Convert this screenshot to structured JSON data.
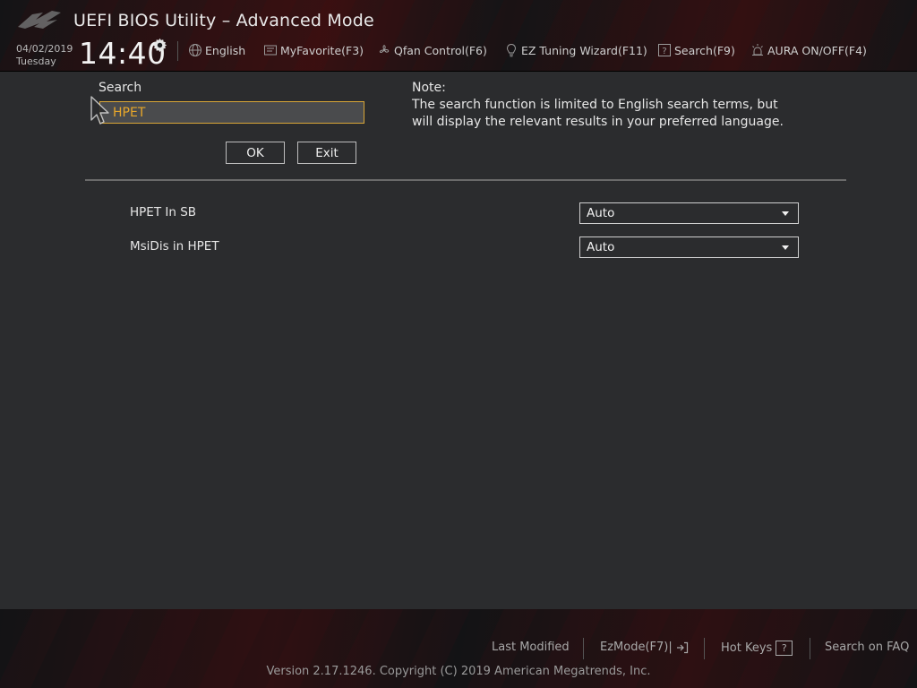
{
  "header": {
    "title": "UEFI BIOS Utility – Advanced Mode",
    "date": "04/02/2019",
    "day": "Tuesday",
    "time": "14:40",
    "toolbar": [
      {
        "icon": "globe-icon",
        "label": "English"
      },
      {
        "icon": "favorite-icon",
        "label": "MyFavorite(F3)"
      },
      {
        "icon": "fan-icon",
        "label": "Qfan Control(F6)"
      },
      {
        "icon": "lightbulb-icon",
        "label": "EZ Tuning Wizard(F11)"
      },
      {
        "icon": "question-icon",
        "label": "Search(F9)"
      },
      {
        "icon": "aura-icon",
        "label": "AURA ON/OFF(F4)"
      }
    ]
  },
  "search": {
    "label": "Search",
    "value": "HPET",
    "ok_label": "OK",
    "exit_label": "Exit"
  },
  "note": {
    "title": "Note:",
    "line1": "The search function is limited to English search terms, but",
    "line2": "will display the relevant results in your preferred language."
  },
  "results": [
    {
      "label": "HPET In SB",
      "value": "Auto"
    },
    {
      "label": "MsiDis in HPET",
      "value": "Auto"
    }
  ],
  "footer": {
    "last_modified": "Last Modified",
    "ezmode": "EzMode(F7)|",
    "hot_keys": "Hot Keys",
    "hot_keys_icon": "?",
    "search_faq": "Search on FAQ",
    "copyright": "Version 2.17.1246. Copyright (C) 2019 American Megatrends, Inc."
  },
  "colors": {
    "accent": "#d8a637",
    "background": "#2b2c2e",
    "search_text": "#e8a72a"
  }
}
